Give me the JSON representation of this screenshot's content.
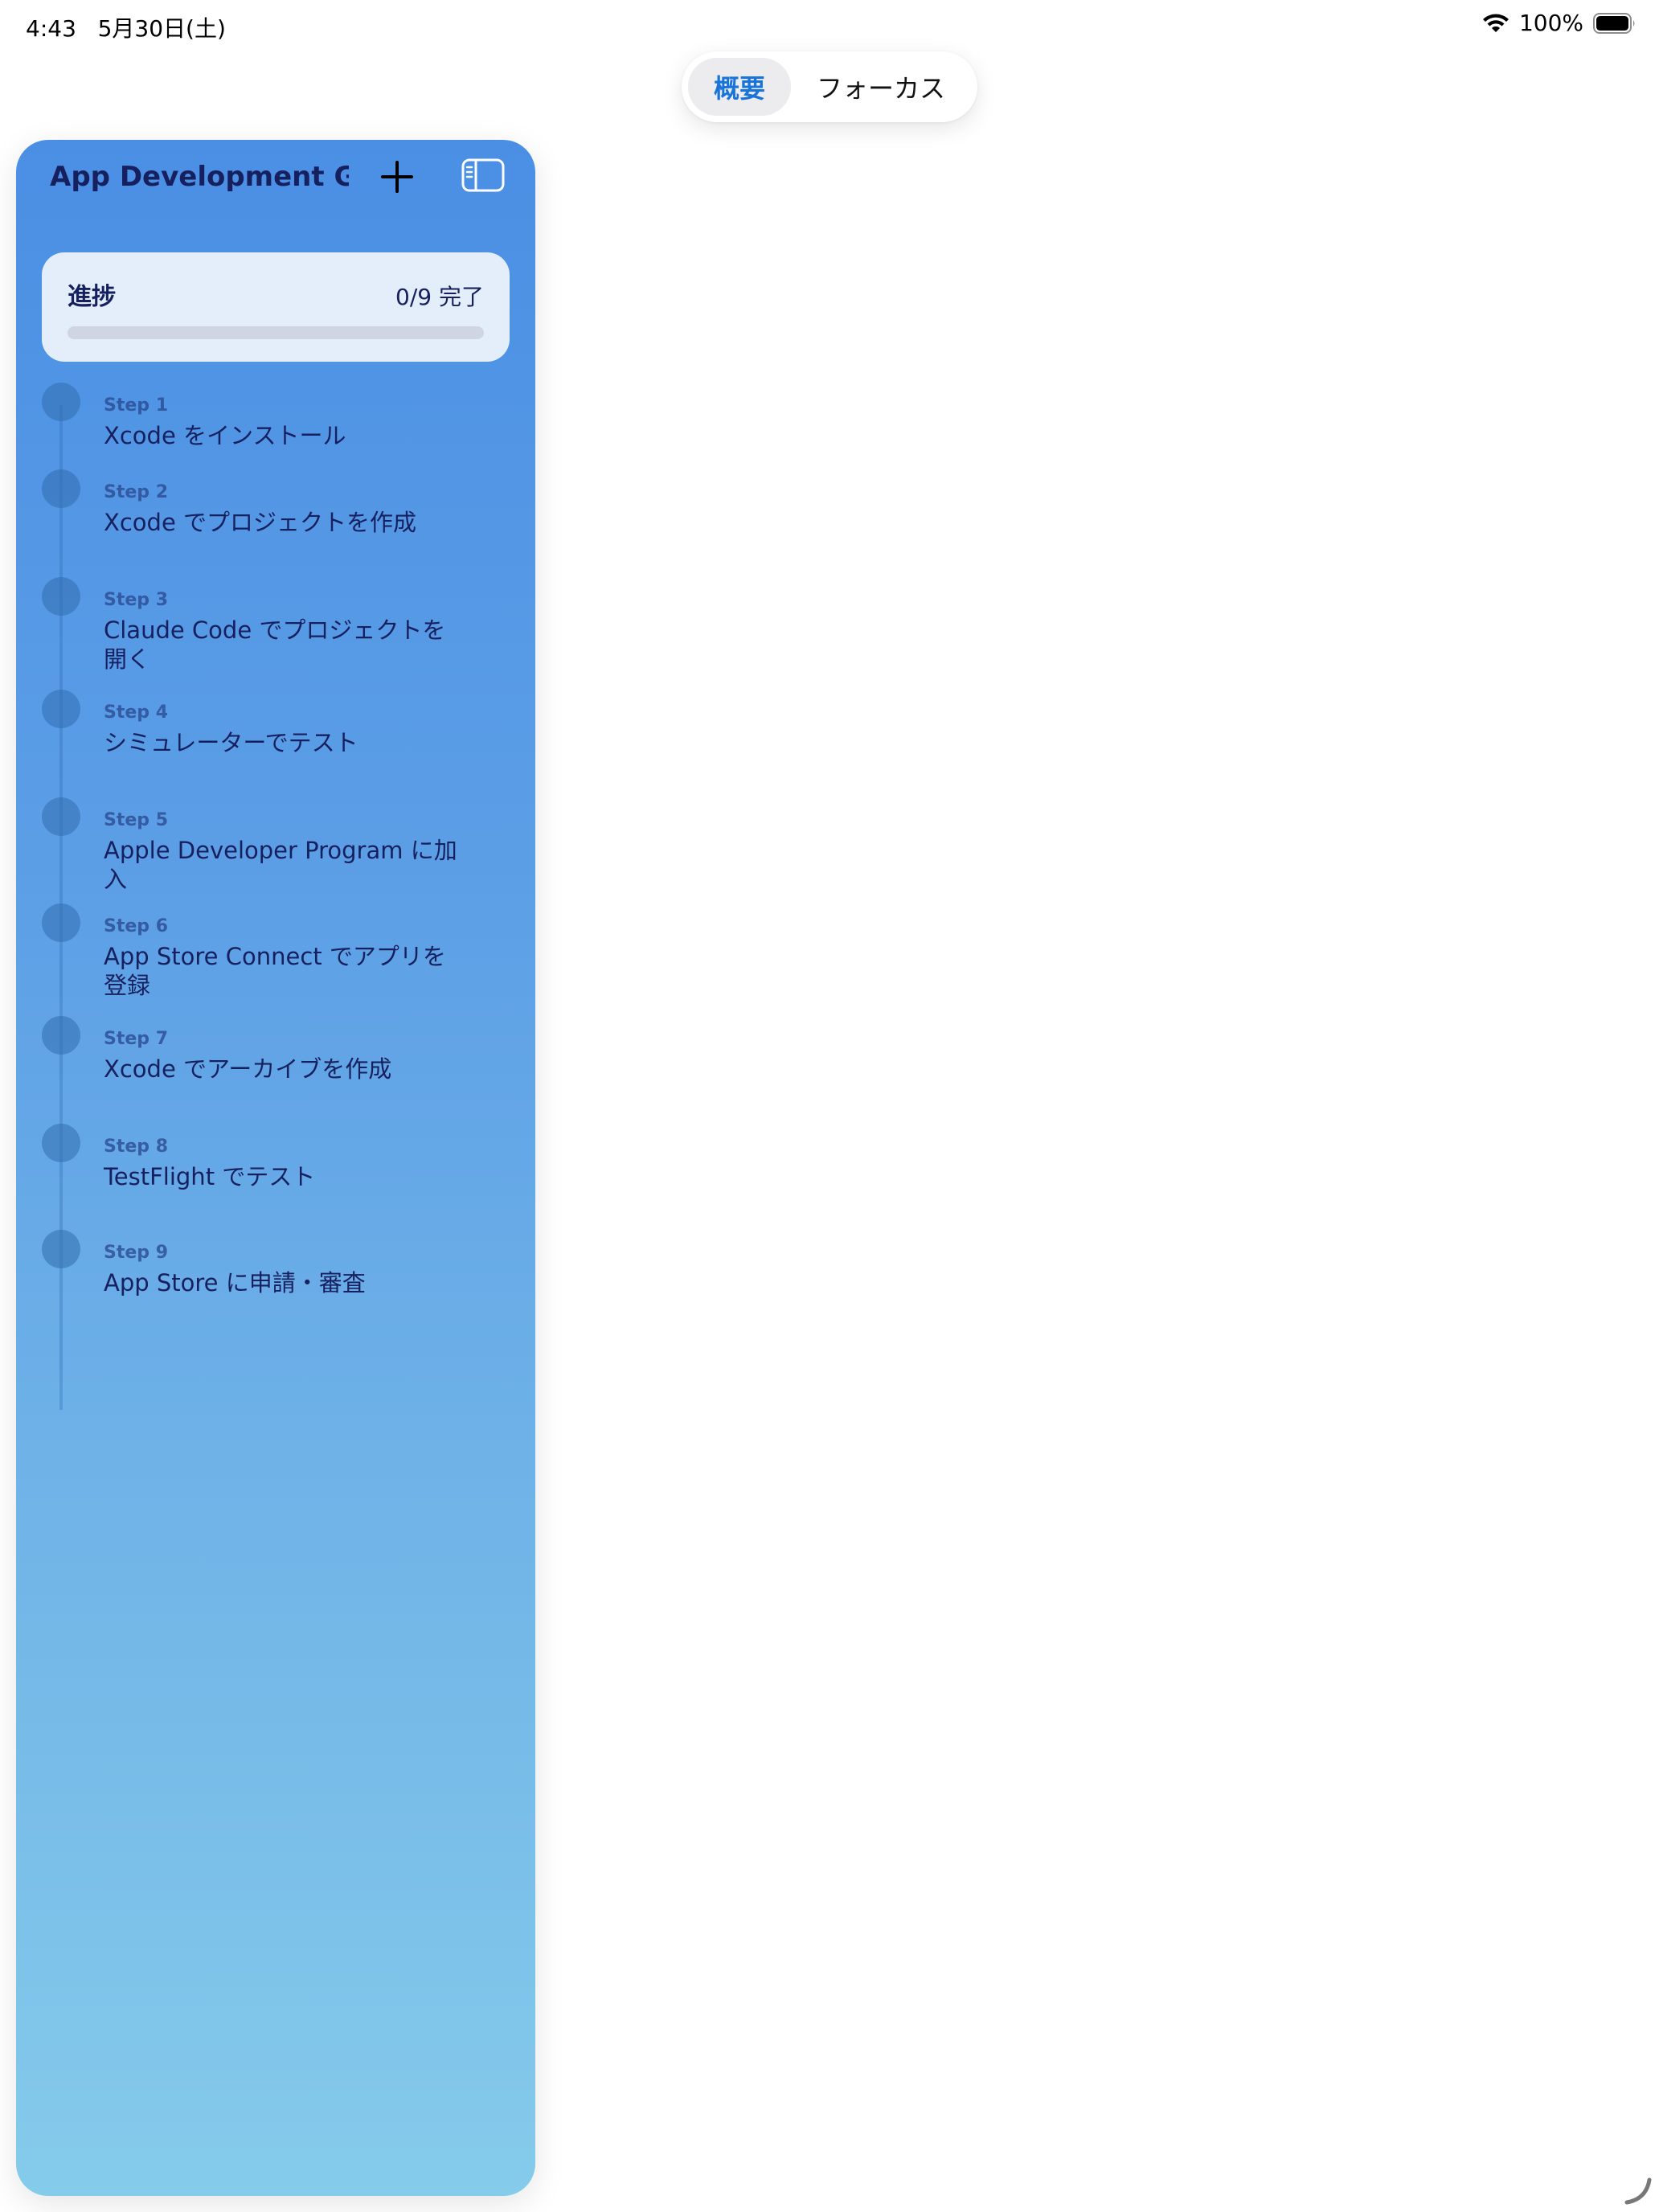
{
  "status_bar": {
    "time": "4:43",
    "date": "5月30日(土)",
    "battery": "100%",
    "wifi_icon": "wifi-icon",
    "battery_icon": "battery-full-icon"
  },
  "segmented": {
    "options": [
      "概要",
      "フォーカス"
    ],
    "selected": "概要"
  },
  "sidebar": {
    "title": "App Development G...",
    "add_icon": "plus-icon",
    "toggle_icon": "sidebar-toggle-icon"
  },
  "progress": {
    "label": "進捗",
    "count": "0/9 完了",
    "completed": 0,
    "total": 9
  },
  "steps": [
    {
      "num": "Step 1",
      "title": "Xcode をインストール"
    },
    {
      "num": "Step 2",
      "title": "Xcode でプロジェクトを作成"
    },
    {
      "num": "Step 3",
      "title": "Claude Code でプロジェクトを開く"
    },
    {
      "num": "Step 4",
      "title": "シミュレーターでテスト"
    },
    {
      "num": "Step 5",
      "title": "Apple Developer Program に加入"
    },
    {
      "num": "Step 6",
      "title": "App Store Connect でアプリを登録"
    },
    {
      "num": "Step 7",
      "title": "Xcode でアーカイブを作成"
    },
    {
      "num": "Step 8",
      "title": "TestFlight でテスト"
    },
    {
      "num": "Step 9",
      "title": "App Store に申請・審査"
    }
  ],
  "colors": {
    "accent": "#1a73d9",
    "title_text": "#17205e",
    "sidebar_top": "#4a8fe4",
    "sidebar_bottom": "#85cbea"
  }
}
